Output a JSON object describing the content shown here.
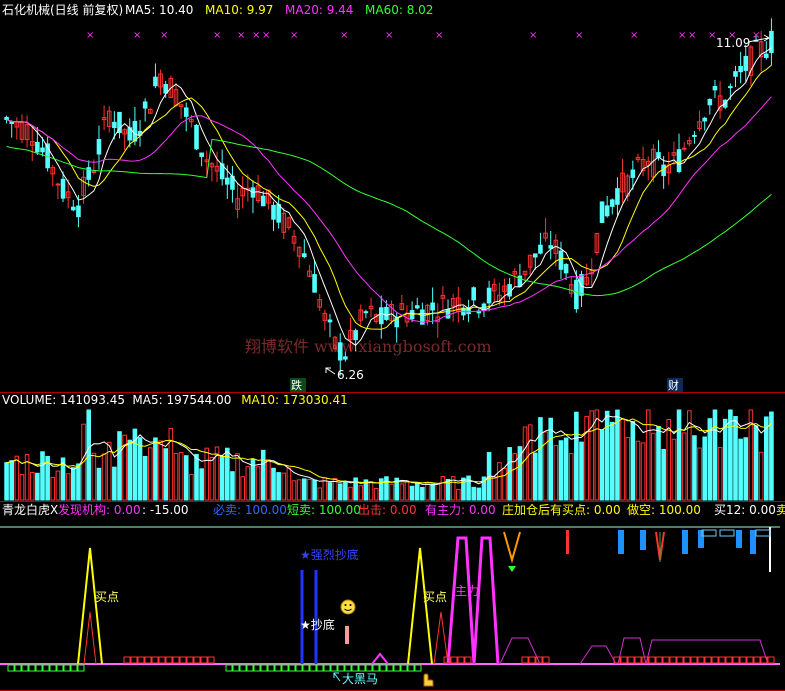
{
  "price_panel": {
    "stock_name": "石化机械(日线 前复权)",
    "ma_labels": [
      {
        "text": "MA5: 10.40",
        "color": "#ffffff"
      },
      {
        "text": "MA10: 9.97",
        "color": "#ffff00"
      },
      {
        "text": "MA20: 9.44",
        "color": "#ff33ff"
      },
      {
        "text": "MA60: 8.02",
        "color": "#33ff33"
      }
    ],
    "high_label": "11.09",
    "low_label": "6.26",
    "marker_die": "跌",
    "marker_cai": "财",
    "x_marks": "××"
  },
  "watermark": "翔博软件 www.xiangbosoft.com",
  "volume_panel": {
    "labels": [
      {
        "text": "VOLUME: 141093.45",
        "color": "#ffffff"
      },
      {
        "text": "MA5: 197544.00",
        "color": "#ffffff"
      },
      {
        "text": "MA10: 173030.41",
        "color": "#ffff00"
      }
    ]
  },
  "indicator_panel": {
    "labels": [
      {
        "text": "青龙白虎X",
        "color": "#ffffff"
      },
      {
        "text": "发现机构: 0.00",
        "color": "#ff33ff"
      },
      {
        "text": ": -15.00",
        "color": "#ffffff"
      },
      {
        "text": "必卖: 100.00",
        "color": "#3366ff"
      },
      {
        "text": "短卖: 100.00",
        "color": "#33ff33"
      },
      {
        "text": "出击: 0.00",
        "color": "#ff3333"
      },
      {
        "text": "有主力: 0.00",
        "color": "#ff33ff"
      },
      {
        "text": "庄加仓后有买点: 0.00",
        "color": "#ffff00"
      },
      {
        "text": "做空: 100.00",
        "color": "#ffff00"
      },
      {
        "text": "买12: 0.00",
        "color": "#ffffff"
      },
      {
        "text": "卖",
        "color": "#ffff00"
      }
    ],
    "buy_label_1": "买点",
    "buy_label_2": "买点",
    "main_force_label": "主力",
    "blue_label": "★强烈抄底",
    "white_label": "★抄底",
    "dahei_label": "大黑马"
  },
  "colors": {
    "up": "#ff3232",
    "down": "#54ffff",
    "ma5": "#ffffff",
    "ma10": "#ffff00",
    "ma20": "#ff33ff",
    "ma60": "#33ff33",
    "frame": "#b00000"
  },
  "chart_data": [
    {
      "type": "candlestick",
      "title": "石化机械(日线 前复权)",
      "ylim": [
        6.0,
        11.4
      ],
      "annotations": {
        "high": 11.09,
        "low": 6.26
      },
      "series": [
        {
          "name": "MA5",
          "value": 10.4
        },
        {
          "name": "MA10",
          "value": 9.97
        },
        {
          "name": "MA20",
          "value": 9.44
        },
        {
          "name": "MA60",
          "value": 8.02
        }
      ]
    },
    {
      "type": "bar",
      "title": "VOLUME",
      "series": [
        {
          "name": "VOLUME",
          "value": 141093.45
        },
        {
          "name": "MA5",
          "value": 197544.0
        },
        {
          "name": "MA10",
          "value": 173030.41
        }
      ]
    },
    {
      "type": "line",
      "title": "青龙白虎X",
      "series": [
        {
          "name": "发现机构",
          "value": 0.0
        },
        {
          "name": "必卖",
          "value": 100.0
        },
        {
          "name": "短卖",
          "value": 100.0
        },
        {
          "name": "出击",
          "value": 0.0
        },
        {
          "name": "有主力",
          "value": 0.0
        },
        {
          "name": "庄加仓后有买点",
          "value": 0.0
        },
        {
          "name": "做空",
          "value": 100.0
        },
        {
          "name": "买12",
          "value": 0.0
        }
      ]
    }
  ]
}
